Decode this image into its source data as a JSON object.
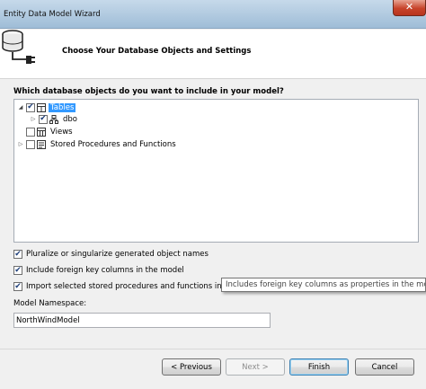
{
  "window": {
    "title": "Entity Data Model Wizard",
    "close_glyph": "✕"
  },
  "header": {
    "heading": "Choose Your Database Objects and Settings",
    "icon": "database-connector-icon"
  },
  "question": "Which database objects do you want to include in your model?",
  "tree": [
    {
      "label": "Tables",
      "checked": true,
      "expanded": true,
      "selected": true
    },
    {
      "label": "dbo",
      "checked": true,
      "expanded": false,
      "selected": false
    },
    {
      "label": "Views",
      "checked": false,
      "selected": false
    },
    {
      "label": "Stored Procedures and Functions",
      "checked": false,
      "expanded": false,
      "selected": false
    }
  ],
  "glyphs": {
    "check": "✔",
    "collapsed": "▷",
    "expanded": "◢"
  },
  "options": [
    {
      "label": "Pluralize or singularize generated object names",
      "checked": true
    },
    {
      "label": "Include foreign key columns in the model",
      "checked": true
    },
    {
      "label": "Import selected stored procedures and functions into t",
      "checked": true
    }
  ],
  "tooltip": "Includes foreign key columns as properties in the model",
  "namespace": {
    "label": "Model Namespace:",
    "value": "NorthWindModel"
  },
  "buttons": {
    "previous": "< Previous",
    "next": "Next >",
    "finish": "Finish",
    "cancel": "Cancel"
  },
  "colors": {
    "selection": "#3399ff",
    "title_gradient_top": "#c6d9ea",
    "title_gradient_bottom": "#9fbdd7",
    "close": "#c7432a"
  }
}
